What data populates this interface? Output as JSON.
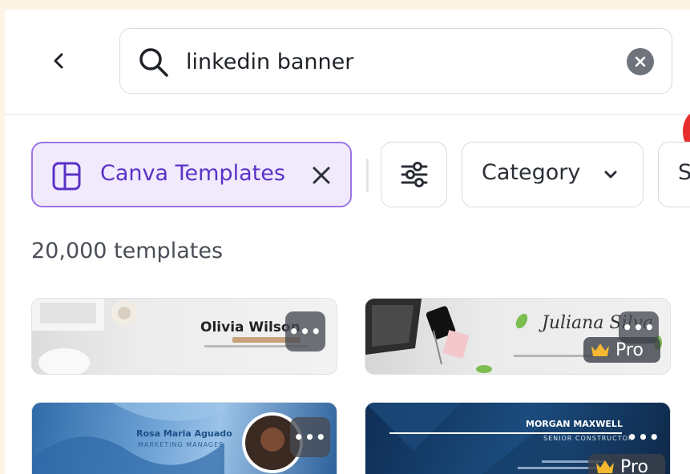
{
  "search": {
    "value": "linkedin banner"
  },
  "filters": {
    "active_chip_label": "Canva Templates",
    "category_label": "Category",
    "partial_chip_label": "S"
  },
  "results": {
    "count_label": "20,000 templates"
  },
  "templates": [
    {
      "name": "Olivia Wilson",
      "pro": false
    },
    {
      "name": "Juliana Silva",
      "pro": true,
      "pro_label": "Pro"
    },
    {
      "name": "Rosa Maria Aguado",
      "subtitle": "MARKETING MANAGER",
      "pro": false
    },
    {
      "name": "MORGAN MAXWELL",
      "subtitle": "SENIOR CONSTRUCTOR",
      "pro": true,
      "pro_label": "Pro"
    }
  ],
  "colors": {
    "accent": "#9a74e6",
    "accent_bg": "#f1eafd",
    "accent_text": "#5a32c6",
    "notification": "#e62e2e",
    "page_bg": "#fdf4e6"
  },
  "icons": {
    "back": "chevron-left-icon",
    "search": "search-icon",
    "clear": "clear-icon",
    "template": "template-icon",
    "close": "close-icon",
    "filter": "sliders-icon",
    "dropdown": "chevron-down-icon",
    "more": "more-icon",
    "pro": "crown-icon"
  }
}
